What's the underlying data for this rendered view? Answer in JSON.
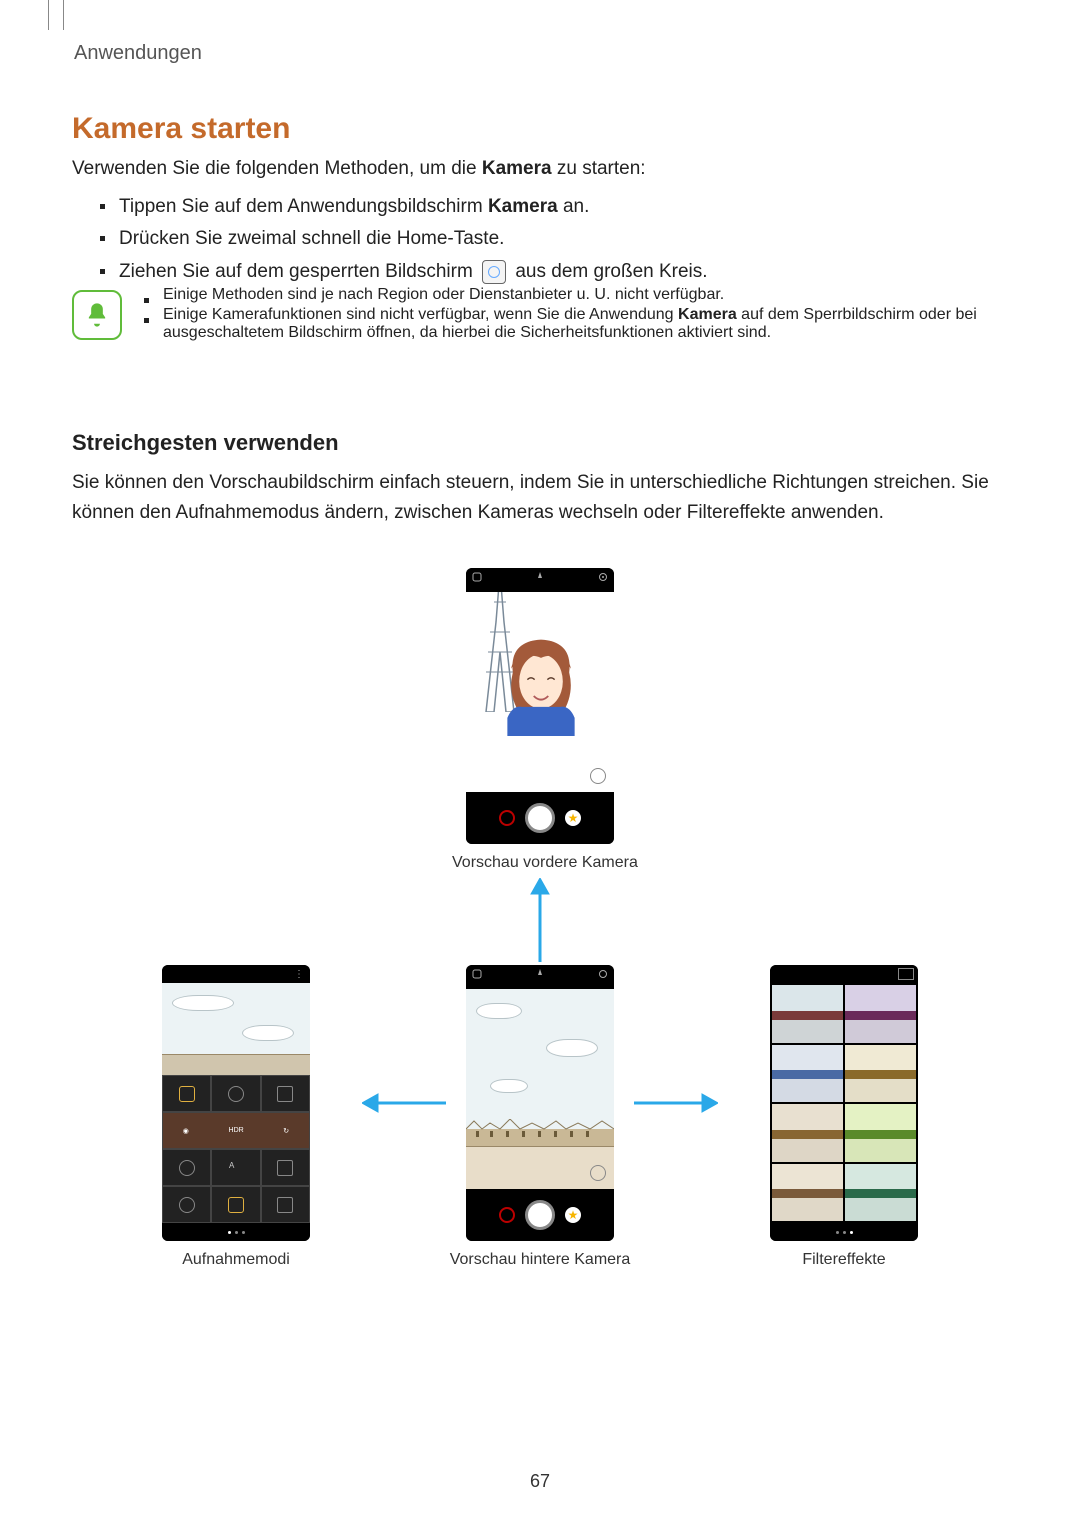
{
  "header": {
    "section": "Anwendungen"
  },
  "h1": "Kamera starten",
  "intro_prefix": "Verwenden Sie die folgenden Methoden, um die ",
  "intro_bold": "Kamera",
  "intro_suffix": " zu starten:",
  "bullets": {
    "b1_pre": "Tippen Sie auf dem Anwendungsbildschirm ",
    "b1_bold": "Kamera",
    "b1_post": " an.",
    "b2": "Drücken Sie zweimal schnell die Home-Taste.",
    "b3_pre": "Ziehen Sie auf dem gesperrten Bildschirm ",
    "b3_post": " aus dem großen Kreis."
  },
  "notes": {
    "n1": "Einige Methoden sind je nach Region oder Dienstanbieter u. U. nicht verfügbar.",
    "n2_pre": "Einige Kamerafunktionen sind nicht verfügbar, wenn Sie die Anwendung ",
    "n2_bold": "Kamera",
    "n2_post": " auf dem Sperrbildschirm oder bei ausgeschaltetem Bildschirm öffnen, da hierbei die Sicherheitsfunktionen aktiviert sind."
  },
  "h2": "Streichgesten verwenden",
  "swipe_desc": "Sie können den Vorschaubildschirm einfach steuern, indem Sie in unterschiedliche Richtungen streichen. Sie können den Aufnahmemodus ändern, zwischen Kameras wechseln oder Filtereffekte anwenden.",
  "captions": {
    "front": "Vorschau vordere Kamera",
    "modes": "Aufnahmemodi",
    "rear": "Vorschau hintere Kamera",
    "filters": "Filtereffekte"
  },
  "icons": {
    "star": "★"
  },
  "page": "67"
}
